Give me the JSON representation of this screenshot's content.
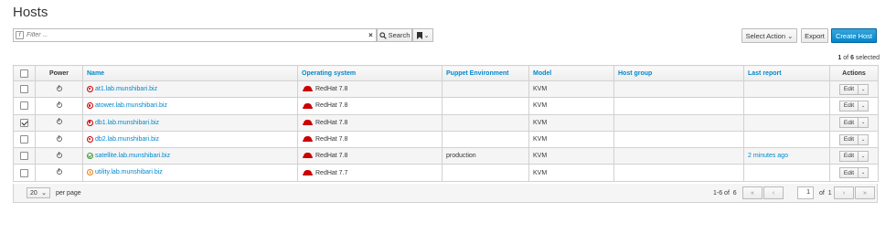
{
  "page": {
    "title": "Hosts"
  },
  "toolbar": {
    "filter_placeholder": "Filter ...",
    "search_label": "Search",
    "select_action_label": "Select Action",
    "export_label": "Export",
    "create_host_label": "Create Host"
  },
  "selection": {
    "selected": "1",
    "of_word": "of",
    "total": "6",
    "suffix": "selected"
  },
  "table": {
    "headers": [
      "Power",
      "Name",
      "Operating system",
      "Puppet Environment",
      "Model",
      "Host group",
      "Last report",
      "Actions"
    ],
    "rows": [
      {
        "checked": false,
        "status": "error",
        "name": "at1.lab.munshibari.biz",
        "os": "RedHat 7.8",
        "puppet_env": "",
        "model": "KVM",
        "host_group": "",
        "last_report": "",
        "action": "Edit"
      },
      {
        "checked": false,
        "status": "error",
        "name": "atower.lab.munshibari.biz",
        "os": "RedHat 7.8",
        "puppet_env": "",
        "model": "KVM",
        "host_group": "",
        "last_report": "",
        "action": "Edit"
      },
      {
        "checked": true,
        "status": "error",
        "name": "db1.lab.munshibari.biz",
        "os": "RedHat 7.8",
        "puppet_env": "",
        "model": "KVM",
        "host_group": "",
        "last_report": "",
        "action": "Edit"
      },
      {
        "checked": false,
        "status": "error",
        "name": "db2.lab.munshibari.biz",
        "os": "RedHat 7.8",
        "puppet_env": "",
        "model": "KVM",
        "host_group": "",
        "last_report": "",
        "action": "Edit"
      },
      {
        "checked": false,
        "status": "ok",
        "name": "satellite.lab.munshibari.biz",
        "os": "RedHat 7.8",
        "puppet_env": "production",
        "model": "KVM",
        "host_group": "",
        "last_report": "2 minutes ago",
        "action": "Edit"
      },
      {
        "checked": false,
        "status": "warning",
        "name": "utility.lab.munshibari.biz",
        "os": "RedHat 7.7",
        "puppet_env": "",
        "model": "KVM",
        "host_group": "",
        "last_report": "",
        "action": "Edit"
      }
    ]
  },
  "pagination": {
    "per_page_value": "20",
    "per_page_label": "per page",
    "range": "1-6 of",
    "total": "6",
    "current_page": "1",
    "of_label": "of",
    "total_pages": "1"
  },
  "colors": {
    "accent": "#0088ce",
    "error": "#cc0000",
    "ok": "#3f9c35",
    "warning": "#ec7a08"
  }
}
